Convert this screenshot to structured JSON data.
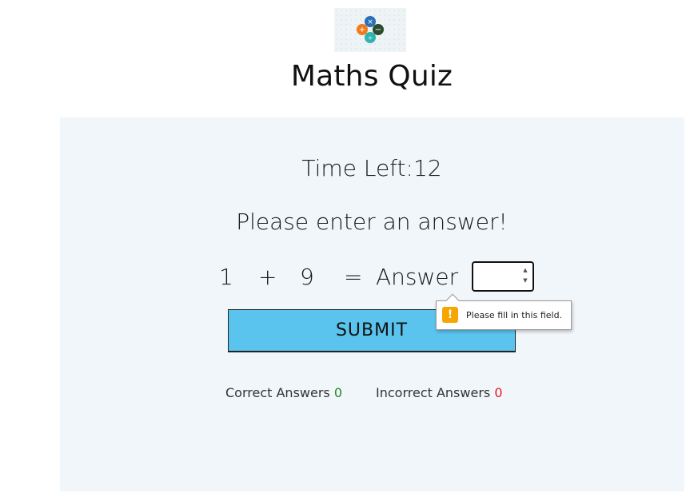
{
  "app": {
    "title": "Maths Quiz",
    "logo_icon": "math-operators-icon"
  },
  "quiz": {
    "time_label": "Time Left:12",
    "message": "Please enter an answer!",
    "operand_a": "1",
    "operator": "+",
    "operand_b": "9",
    "equals": "=",
    "answer_label": "Answer",
    "answer_value": "",
    "submit_label": "SUBMIT"
  },
  "validation": {
    "tooltip_text": "Please fill in this field.",
    "warning_icon": "exclamation-icon"
  },
  "scores": {
    "correct_label": "Correct Answers",
    "correct_value": "0",
    "incorrect_label": "Incorrect Answers",
    "incorrect_value": "0"
  },
  "colors": {
    "panel_bg": "#f1f6fa",
    "submit_bg": "#5bc4ee",
    "correct": "#1f8a1f",
    "incorrect": "#e51c1c",
    "warning": "#f7a500"
  }
}
